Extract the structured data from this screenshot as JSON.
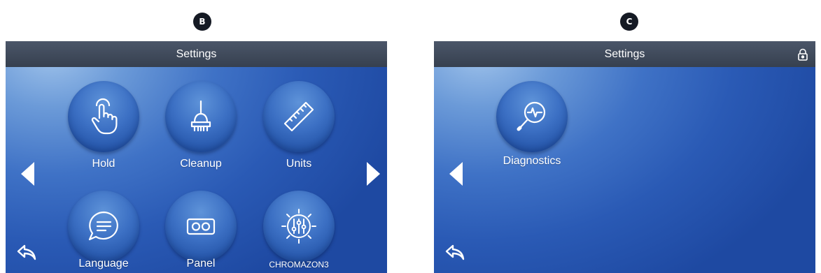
{
  "markers": {
    "left": "B",
    "right": "C"
  },
  "left_panel": {
    "title": "Settings",
    "buttons": [
      {
        "label": "Hold",
        "icon": "hand-touch-icon"
      },
      {
        "label": "Cleanup",
        "icon": "broom-icon"
      },
      {
        "label": "Units",
        "icon": "ruler-icon"
      },
      {
        "label": "Language",
        "icon": "speech-bubble-icon"
      },
      {
        "label": "Panel",
        "icon": "panel-icon"
      },
      {
        "label": "CHROMAZON3",
        "icon": "chromazon3-icon"
      }
    ],
    "nav": {
      "prev_icon": "left-arrow-icon",
      "next_icon": "right-arrow-icon",
      "back_icon": "back-icon"
    }
  },
  "right_panel": {
    "title": "Settings",
    "lock_icon": "lock-icon",
    "buttons": [
      {
        "label": "Diagnostics",
        "icon": "diagnostics-icon"
      }
    ],
    "nav": {
      "prev_icon": "left-arrow-icon",
      "back_icon": "back-icon"
    }
  },
  "colors": {
    "accent": "#2a5ab5",
    "titlebar": "#3d4757",
    "text": "#ffffff",
    "marker": "#151a24"
  }
}
